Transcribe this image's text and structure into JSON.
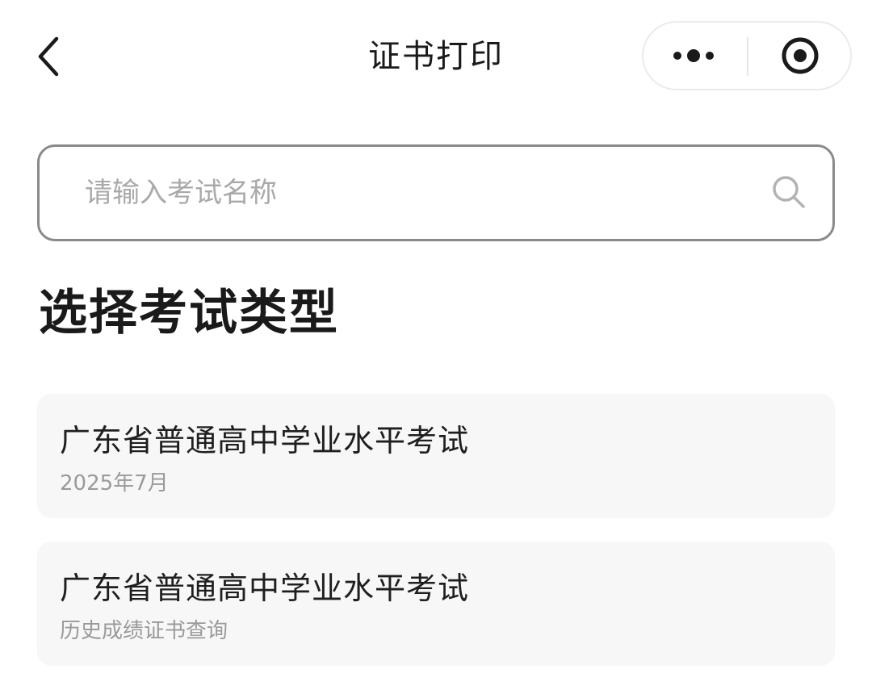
{
  "nav": {
    "title": "证书打印",
    "back_icon": "chevron-left-icon",
    "more_icon": "more-dots-icon",
    "close_icon": "miniprogram-close-icon"
  },
  "search": {
    "placeholder": "请输入考试名称",
    "value": "",
    "icon": "search-icon"
  },
  "section": {
    "title": "选择考试类型"
  },
  "exams": [
    {
      "title": "广东省普通高中学业水平考试",
      "subtitle": "2025年7月"
    },
    {
      "title": "广东省普通高中学业水平考试",
      "subtitle": "历史成绩证书查询"
    }
  ],
  "colors": {
    "text": "#1a1a1a",
    "placeholder": "#a9a9a9",
    "card_bg": "#f7f7f7",
    "subtitle": "#9a9a9a",
    "border": "#8a8a8a"
  }
}
